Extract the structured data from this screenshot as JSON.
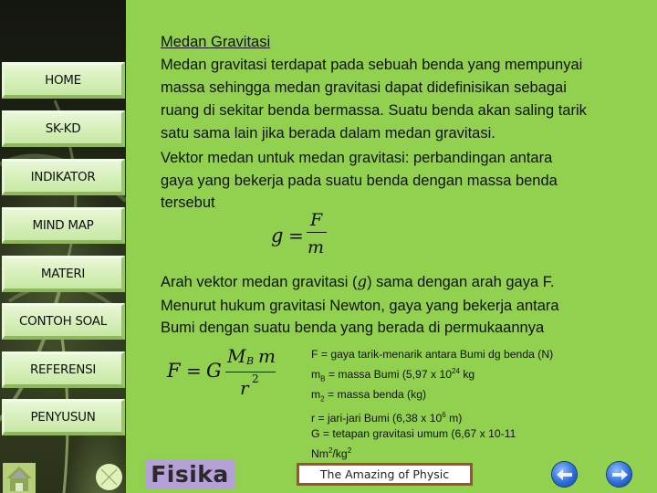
{
  "sidebar": {
    "items": [
      {
        "label": "HOME"
      },
      {
        "label": "SK-KD"
      },
      {
        "label": "INDIKATOR"
      },
      {
        "label": "MIND MAP"
      },
      {
        "label": "MATERI"
      },
      {
        "label": "CONTOH SOAL"
      },
      {
        "label": "REFERENSI"
      },
      {
        "label": "PENYUSUN"
      }
    ],
    "home_icon": "home-icon",
    "close_icon": "close-circle-icon"
  },
  "content": {
    "title": "Medan Gravitasi",
    "paragraph1": [
      "Medan gravitasi terdapat pada sebuah benda yang mempunyai",
      "massa sehingga medan gravitasi dapat didefinisikan sebagai",
      "ruang di sekitar benda bermassa. Suatu benda akan saling tarik",
      "satu sama lain jika berada dalam medan gravitasi."
    ],
    "paragraph2": [
      "Vektor medan untuk medan gravitasi: perbandingan antara",
      "gaya yang bekerja pada suatu benda dengan massa benda",
      "tersebut"
    ],
    "formula1": {
      "lhs": "g",
      "eq": "=",
      "numerator": "F",
      "denominator": "m"
    },
    "paragraph3": [
      "Arah vektor medan gravitasi (",
      "g",
      ") sama dengan arah gaya F."
    ],
    "paragraph4": [
      "Menurut hukum gravitasi Newton, gaya yang bekerja antara",
      "Bumi dengan suatu benda yang berada di permukaannya"
    ],
    "formula2": {
      "lhs": "F",
      "eq": "=",
      "const": "G",
      "num_main": "M",
      "num_sub": "B",
      "num_tail": "m",
      "den": "r",
      "den_exp": "2"
    },
    "legend": {
      "l1": "F = gaya tarik-menarik antara Bumi dg benda (N)",
      "l2_a": "m",
      "l2_sub": "B",
      "l2_b": " = massa Bumi (5,97 x 10",
      "l2_sup": "24",
      "l2_c": " kg",
      "l3_a": "m",
      "l3_sub": "2",
      "l3_b": " = massa benda (kg)",
      "l4_a": "r  = jari-jari Bumi (6,38 x 10",
      "l4_sup": "6",
      "l4_b": " m)",
      "l5": "G = tetapan gravitasi umum (6,67 x 10-11",
      "l6_a": "Nm",
      "l6_sup1": "2",
      "l6_b": "/kg",
      "l6_sup2": "2"
    }
  },
  "footer": {
    "logo": "Fisika",
    "tagline": "The Amazing of Physic",
    "prev_icon": "arrow-left-icon",
    "next_icon": "arrow-right-icon"
  },
  "colors": {
    "background": "#92d050",
    "button_face": "#d8f0bd",
    "tagline_border": "#a0522d",
    "logo_bg": "#b6a0d8",
    "arrow_blue": "#2e6fdc"
  }
}
